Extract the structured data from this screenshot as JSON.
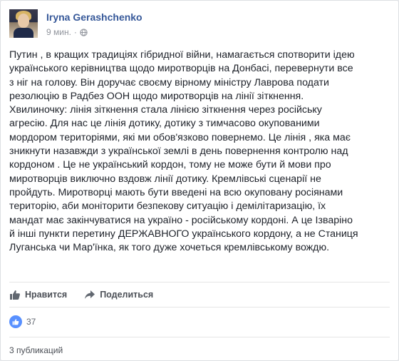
{
  "post": {
    "author": "Iryna Gerashchenko",
    "time": "9 мин.",
    "separator": "·",
    "privacy_icon": "globe-icon",
    "text": "Путин , в кращих традиціях гібридної війни, намагається спотворити ідею\nукраїнського керівництва щодо миротворців на Донбасі, перевернути все\nз ніг на голову. Він доручає своєму вірному міністру Лаврова подати\nрезолюцію в Радбез ООН щодо миротворців на лінії зіткнення.\nХвилиночку: лінія зіткнення стала лінією зіткнення через російську\nагресію. Для нас це лінія дотику, дотику з тимчасово окупованими\nмордором територіями, які ми обов'язково повернемо. Це лінія , яка має\nзникнути назавжди з української землі в день повернення контролю над\nкордоном . Це не український кордон, тому не може бути й мови про\nмиротворців виключно вздовж лінії дотику. Кремлівські сценарії не\nпройдуть. Миротворці мають бути введені на всю окуповану росіянами\nтериторію, аби моніторити безпекову ситуацію і демілітаризацію, їх\nмандат має закінчуватися на україно - російському кордоні. А це Ізваріно\nй інші пункти перетину ДЕРЖАВНОГО українського кордону, а не Станиця\nЛуганська чи Мар'їнка, як того дуже хочеться кремлівському вождю."
  },
  "actions": {
    "like_label": "Нравится",
    "share_label": "Поделиться"
  },
  "reactions": {
    "like_count": "37",
    "shares_label": "3 публикаций"
  },
  "colors": {
    "link": "#365899",
    "like_blue": "#5890ff",
    "text": "#1d2129",
    "muted": "#90949c"
  }
}
